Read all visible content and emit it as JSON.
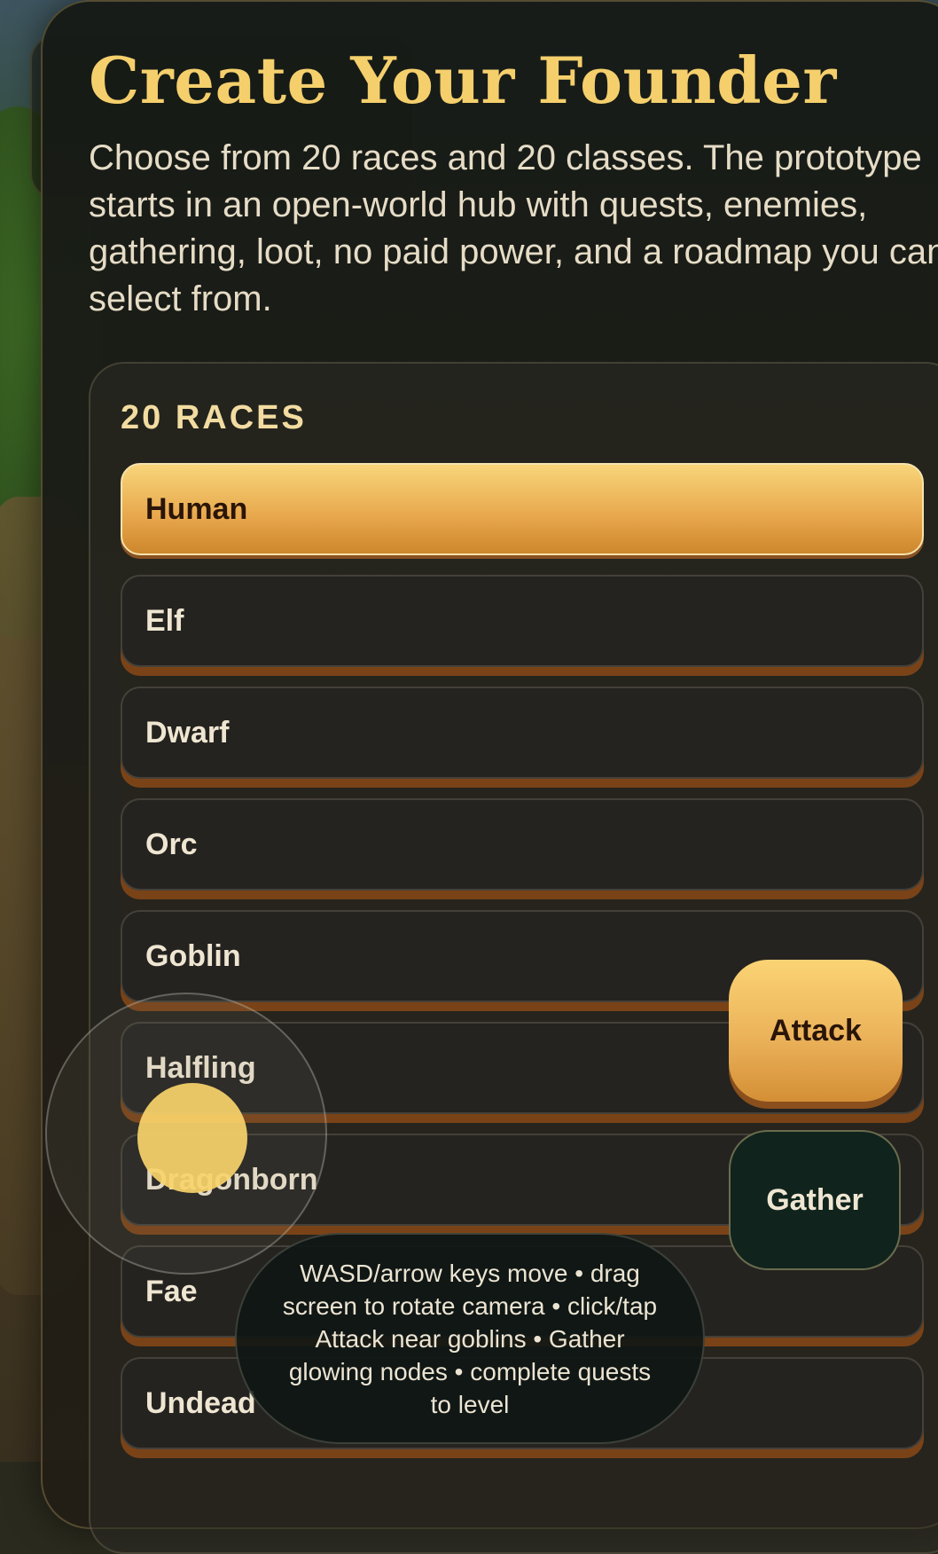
{
  "title": "Create Your Founder",
  "subtitle": "Choose from 20 races and 20 classes. The prototype starts in an open-world hub with quests, enemies, gathering, loot, no paid power, and a roadmap you can select from.",
  "races": {
    "heading": "20 RACES",
    "selected": "Human",
    "items": [
      "Human",
      "Elf",
      "Dwarf",
      "Orc",
      "Goblin",
      "Halfling",
      "Dragonborn",
      "Fae",
      "Undead"
    ]
  },
  "actions": {
    "attack_label": "Attack",
    "gather_label": "Gather"
  },
  "hint": "WASD/arrow keys move • drag screen to rotate camera • click/tap Attack near goblins • Gather glowing nodes • complete quests to level",
  "colors": {
    "accent": "#f4cf6c",
    "selected_fill": "#e7a64b",
    "item_shadow": "#7a4317"
  }
}
